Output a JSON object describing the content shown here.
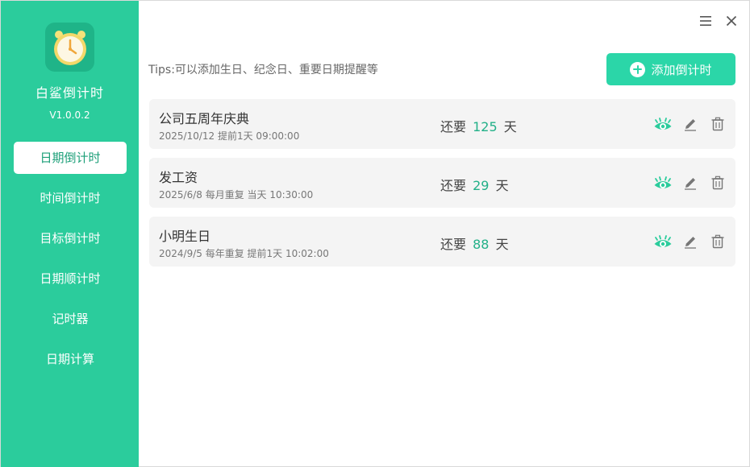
{
  "app": {
    "name": "白鲨倒计时",
    "version": "V1.0.0.2"
  },
  "colors": {
    "sidebar": "#2bcc9c",
    "accent": "#2bd6a8",
    "days": "#22b088"
  },
  "nav": [
    {
      "label": "日期倒计时",
      "active": true
    },
    {
      "label": "时间倒计时",
      "active": false
    },
    {
      "label": "目标倒计时",
      "active": false
    },
    {
      "label": "日期顺计时",
      "active": false
    },
    {
      "label": "记时器",
      "active": false
    },
    {
      "label": "日期计算",
      "active": false
    }
  ],
  "window_controls": {
    "menu_icon": "menu-icon",
    "close_icon": "close-icon"
  },
  "tips": "Tips:可以添加生日、纪念日、重要日期提醒等",
  "add_button": {
    "label": "添加倒计时",
    "icon": "plus-circle-icon"
  },
  "events": [
    {
      "title": "公司五周年庆典",
      "meta": "2025/10/12 提前1天 09:00:00",
      "prefix": "还要",
      "days": "125",
      "unit": "天"
    },
    {
      "title": "发工资",
      "meta": "2025/6/8 每月重复 当天 10:30:00",
      "prefix": "还要",
      "days": "29",
      "unit": "天"
    },
    {
      "title": "小明生日",
      "meta": "2024/9/5 每年重复 提前1天 10:02:00",
      "prefix": "还要",
      "days": "88",
      "unit": "天"
    }
  ]
}
